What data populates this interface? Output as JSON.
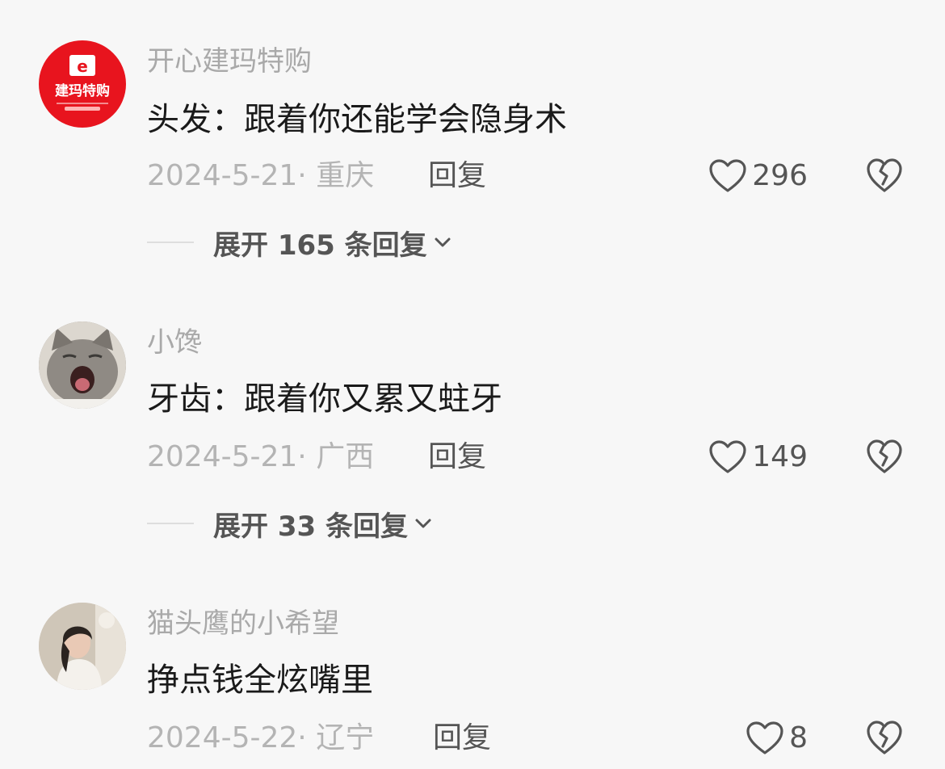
{
  "comments": [
    {
      "username": "开心建玛特购",
      "avatar_text": "建玛特购",
      "text": "头发：跟着你还能学会隐身术",
      "meta": "2024-5-21· 重庆",
      "reply": "回复",
      "likes": "296",
      "expand": "展开 165 条回复"
    },
    {
      "username": "小馋",
      "text": "牙齿：跟着你又累又蛀牙",
      "meta": "2024-5-21· 广西",
      "reply": "回复",
      "likes": "149",
      "expand": "展开 33 条回复"
    },
    {
      "username": "猫头鹰的小希望",
      "text": "挣点钱全炫嘴里",
      "meta": "2024-5-22· 辽宁",
      "reply": "回复",
      "likes": "8"
    }
  ],
  "colors": {
    "background": "#f7f7f7",
    "avatar_red": "#e8141e",
    "username": "#a9a9a9",
    "meta": "#b4b4b4",
    "action": "#555555"
  },
  "icons": [
    "heart-outline-icon",
    "broken-heart-icon",
    "chevron-down-icon"
  ]
}
